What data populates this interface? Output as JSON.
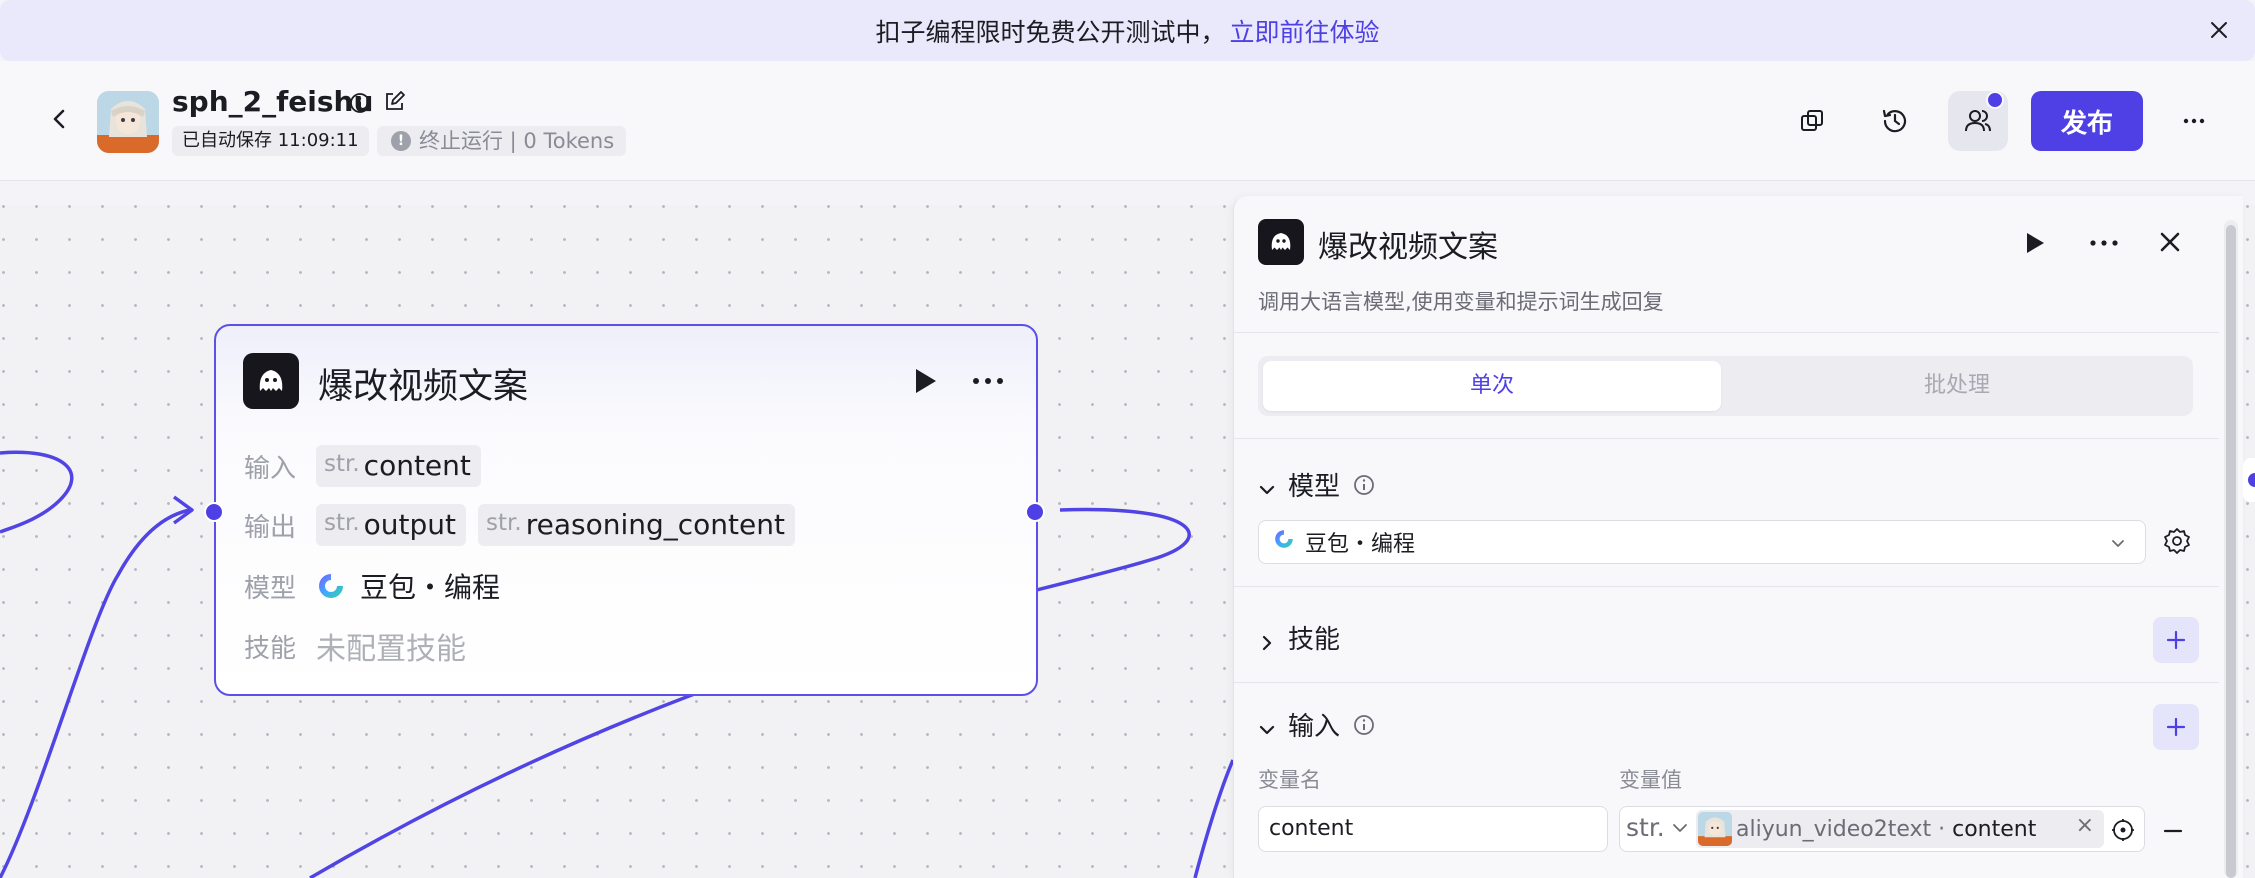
{
  "banner": {
    "text": "扣子编程限时免费公开测试中，",
    "link": "立即前往体验"
  },
  "header": {
    "project_name": "sph_2_feishu",
    "save_status": "已自动保存 11:09:11",
    "run_status": "终止运行 | 0 Tokens",
    "publish_label": "发布"
  },
  "node": {
    "title": "爆改视频文案",
    "input_label": "输入",
    "output_label": "输出",
    "model_label": "模型",
    "skill_label": "技能",
    "type_prefix": "str.",
    "inputs": [
      "content"
    ],
    "outputs": [
      "output",
      "reasoning_content"
    ],
    "model": "豆包・编程",
    "skill_value": "未配置技能"
  },
  "panel": {
    "title": "爆改视频文案",
    "description": "调用大语言模型,使用变量和提示词生成回复",
    "tab_single": "单次",
    "tab_batch": "批处理",
    "model_section": "模型",
    "model_value": "豆包・编程",
    "skill_section": "技能",
    "input_section": "输入",
    "col_name": "变量名",
    "col_value": "变量值",
    "var_name": "content",
    "var_type": "str.",
    "ref_source": "aliyun_video2text",
    "ref_sep": " · ",
    "ref_field": "content",
    "ref_clear": "×"
  },
  "colors": {
    "accent": "#4e40e5",
    "banner_bg": "#e9e9fb",
    "canvas_bg": "#f2f2f4"
  }
}
